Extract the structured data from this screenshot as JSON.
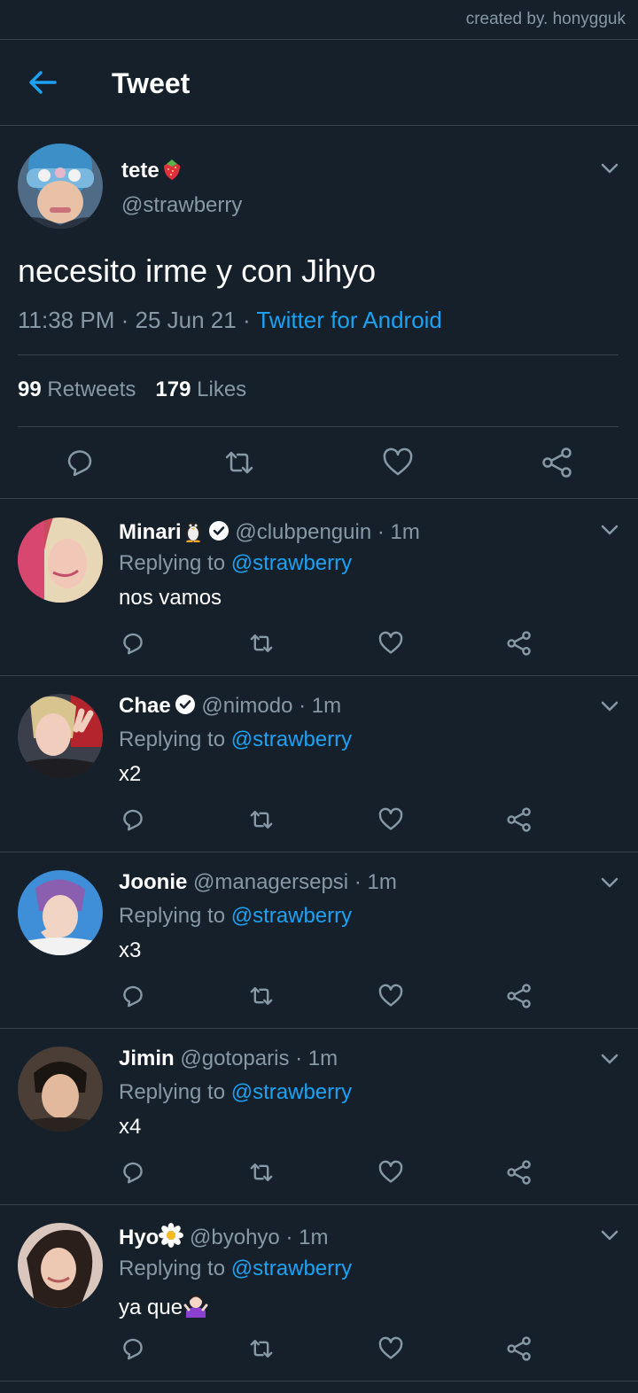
{
  "credit": "created by. honygguk",
  "header": {
    "title": "Tweet"
  },
  "main_tweet": {
    "name": "tete",
    "name_emoji": "strawberry-emoji",
    "handle": "@strawberry",
    "text": "necesito irme y con Jihyo",
    "time": "11:38 PM",
    "date": "25 Jun 21",
    "source": "Twitter for Android",
    "retweets_count": "99",
    "retweets_label": "Retweets",
    "likes_count": "179",
    "likes_label": "Likes"
  },
  "replies": [
    {
      "name": "Minari",
      "name_emoji": "penguin-emoji",
      "verified": true,
      "handle": "@clubpenguin",
      "time": "1m",
      "replying_label": "Replying to",
      "mention": "@strawberry",
      "text": "nos vamos"
    },
    {
      "name": "Chae",
      "verified": true,
      "handle": "@nimodo",
      "time": "1m",
      "replying_label": "Replying to",
      "mention": "@strawberry",
      "text": "x2"
    },
    {
      "name": "Joonie",
      "verified": false,
      "handle": "@managersepsi",
      "time": "1m",
      "replying_label": "Replying to",
      "mention": "@strawberry",
      "text": "x3"
    },
    {
      "name": "Jimin",
      "verified": false,
      "handle": "@gotoparis",
      "time": "1m",
      "replying_label": "Replying to",
      "mention": "@strawberry",
      "text": "x4"
    },
    {
      "name": "Hyo",
      "name_emoji": "daisy-emoji",
      "verified": false,
      "handle": "@byohyo",
      "time": "1m",
      "replying_label": "Replying to",
      "mention": "@strawberry",
      "text": "ya que",
      "text_emoji": "person-shrugging-emoji"
    }
  ],
  "colors": {
    "background": "#15202b",
    "accent": "#1da1f2",
    "secondary_text": "#8899a6",
    "divider": "#38444d"
  }
}
